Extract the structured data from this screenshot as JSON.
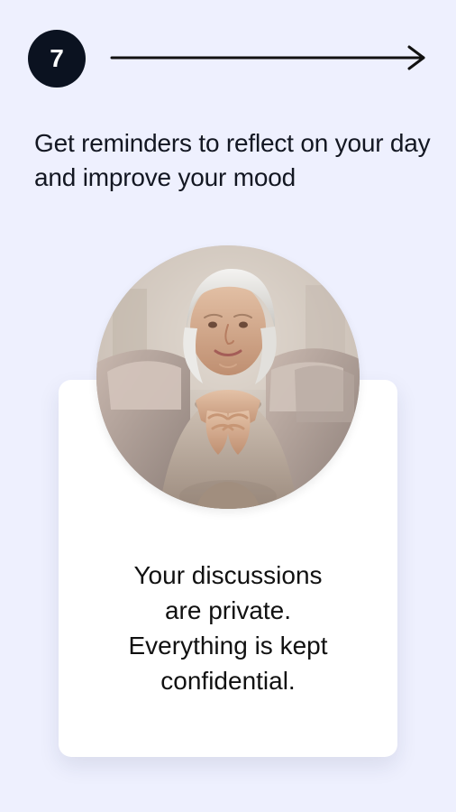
{
  "step": {
    "number": "7"
  },
  "navigation": {
    "next_icon": "arrow-right-icon"
  },
  "headline": "Get reminders to reflect on your day and improve your mood",
  "card": {
    "image_alt": "smiling older woman portrait",
    "text_lines": [
      "Your discussions",
      "are private.",
      "Everything is kept",
      "confidential."
    ]
  },
  "colors": {
    "background": "#eef0fe",
    "badge": "#0b1220",
    "text": "#131722",
    "card": "#ffffff"
  }
}
